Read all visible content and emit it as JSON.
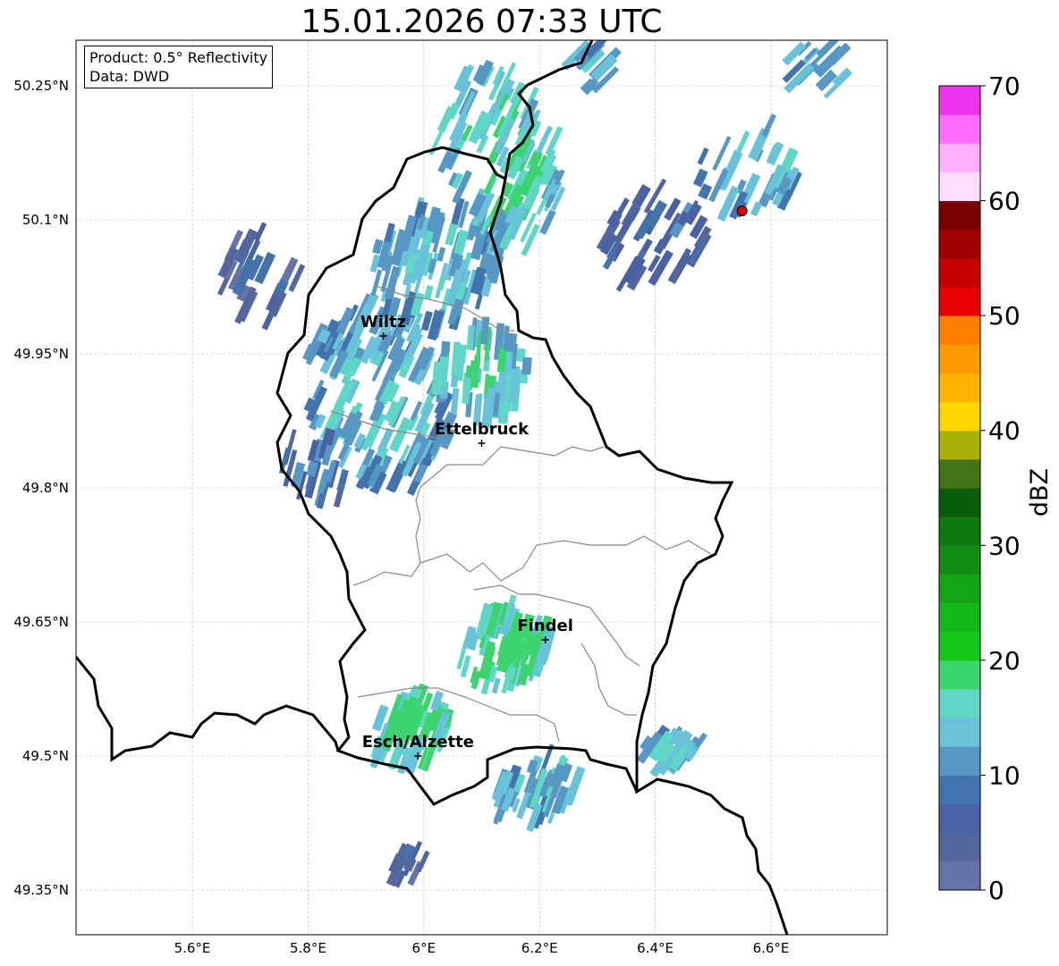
{
  "title": "15.01.2026 07:33 UTC",
  "info_box": {
    "line1": "Product: 0.5° Reflectivity",
    "line2": "Data: DWD"
  },
  "axes": {
    "lon_ticks": [
      "5.6°E",
      "5.8°E",
      "6°E",
      "6.2°E",
      "6.4°E",
      "6.6°E"
    ],
    "lat_ticks": [
      "50.25°N",
      "50.1°N",
      "49.95°N",
      "49.8°N",
      "49.65°N",
      "49.5°N",
      "49.35°N"
    ]
  },
  "cities": [
    {
      "name": "Wiltz",
      "lon": 5.93,
      "lat": 49.97
    },
    {
      "name": "Ettelbruck",
      "lon": 6.1,
      "lat": 49.85
    },
    {
      "name": "Findel",
      "lon": 6.21,
      "lat": 49.63
    },
    {
      "name": "Esch/Alzette",
      "lon": 5.99,
      "lat": 49.5
    }
  ],
  "radar_site": {
    "lon": 6.55,
    "lat": 50.11
  },
  "colorbar": {
    "label": "dBZ",
    "tick_labels": [
      "0",
      "10",
      "20",
      "30",
      "40",
      "50",
      "60",
      "70"
    ],
    "colors": [
      "#6673a8",
      "#54679d",
      "#4a62a3",
      "#4373ad",
      "#5697c4",
      "#69c1da",
      "#5fd6c6",
      "#3cd46e",
      "#12c818",
      "#12b818",
      "#14a514",
      "#128c12",
      "#0e7a0e",
      "#0a5e0a",
      "#437516",
      "#aab208",
      "#ffd700",
      "#ffb400",
      "#ff9a00",
      "#ff7f00",
      "#e60000",
      "#c60000",
      "#a00000",
      "#7a0000",
      "#ffddff",
      "#ffb0ff",
      "#ff6cff",
      "#ee33ee"
    ]
  },
  "radar_areas": [
    {
      "lon": 5.92,
      "lat": 49.9,
      "a": 0.13,
      "b": 0.1,
      "rot": -20,
      "level": 5,
      "n": 140
    },
    {
      "lon": 6.02,
      "lat": 50.05,
      "a": 0.11,
      "b": 0.07,
      "rot": -30,
      "level": 5,
      "n": 90
    },
    {
      "lon": 6.13,
      "lat": 50.17,
      "a": 0.1,
      "b": 0.1,
      "rot": -20,
      "level": 6,
      "n": 110
    },
    {
      "lon": 6.1,
      "lat": 49.93,
      "a": 0.08,
      "b": 0.05,
      "rot": -40,
      "level": 6,
      "n": 60
    },
    {
      "lon": 6.14,
      "lat": 49.62,
      "a": 0.08,
      "b": 0.04,
      "rot": -30,
      "level": 7,
      "n": 70
    },
    {
      "lon": 5.98,
      "lat": 49.53,
      "a": 0.07,
      "b": 0.035,
      "rot": -25,
      "level": 7,
      "n": 55
    },
    {
      "lon": 6.19,
      "lat": 49.46,
      "a": 0.08,
      "b": 0.03,
      "rot": -25,
      "level": 5,
      "n": 45
    },
    {
      "lon": 6.4,
      "lat": 50.08,
      "a": 0.09,
      "b": 0.05,
      "rot": -15,
      "level": 3,
      "n": 40
    },
    {
      "lon": 6.57,
      "lat": 50.16,
      "a": 0.1,
      "b": 0.05,
      "rot": -20,
      "level": 5,
      "n": 35
    },
    {
      "lon": 5.81,
      "lat": 49.82,
      "a": 0.05,
      "b": 0.04,
      "rot": -30,
      "level": 3,
      "n": 20
    },
    {
      "lon": 6.43,
      "lat": 49.51,
      "a": 0.05,
      "b": 0.02,
      "rot": -10,
      "level": 5,
      "n": 20
    },
    {
      "lon": 6.29,
      "lat": 50.27,
      "a": 0.03,
      "b": 0.03,
      "rot": 0,
      "level": 5,
      "n": 12
    },
    {
      "lon": 6.68,
      "lat": 50.27,
      "a": 0.05,
      "b": 0.03,
      "rot": 0,
      "level": 5,
      "n": 14
    },
    {
      "lon": 5.72,
      "lat": 50.04,
      "a": 0.06,
      "b": 0.05,
      "rot": -20,
      "level": 2,
      "n": 25
    },
    {
      "lon": 5.97,
      "lat": 49.38,
      "a": 0.03,
      "b": 0.02,
      "rot": -20,
      "level": 2,
      "n": 10
    }
  ]
}
